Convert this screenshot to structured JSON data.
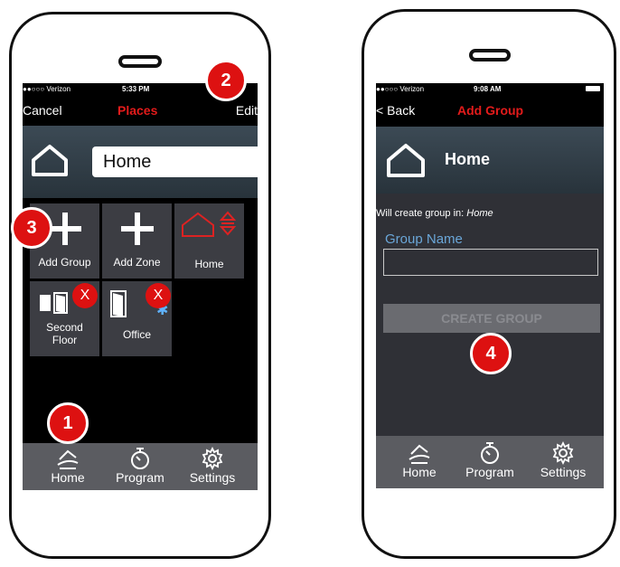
{
  "left_phone": {
    "status": {
      "carrier": "●●○○○ Verizon",
      "time": "5:33 PM"
    },
    "nav": {
      "cancel": "Cancel",
      "title": "Places",
      "edit": "Edit"
    },
    "place_name": "Home",
    "tiles": [
      {
        "label": "Add Group"
      },
      {
        "label": "Add Zone"
      },
      {
        "label": "Home"
      },
      {
        "label": "Second\nFloor",
        "badge": "X"
      },
      {
        "label": "Office",
        "badge": "X"
      }
    ],
    "tabs": {
      "home": "Home",
      "program": "Program",
      "settings": "Settings"
    },
    "callouts": {
      "c1": "1",
      "c2": "2",
      "c3": "3"
    }
  },
  "right_phone": {
    "status": {
      "carrier": "●●○○○ Verizon",
      "time": "9:08 AM"
    },
    "nav": {
      "back": "< Back",
      "title": "Add Group"
    },
    "place_name": "Home",
    "info_prefix": "Will create group in: ",
    "info_place": "Home",
    "group_name_label": "Group Name",
    "group_name_value": "",
    "create_button": "CREATE GROUP",
    "tabs": {
      "home": "Home",
      "program": "Program",
      "settings": "Settings"
    },
    "callouts": {
      "c4": "4"
    }
  },
  "colors": {
    "accent_red": "#dd1111",
    "link_blue": "#6aa6d8",
    "tile_bg": "#3c3d43",
    "tabbar_bg": "#5b5c61"
  }
}
